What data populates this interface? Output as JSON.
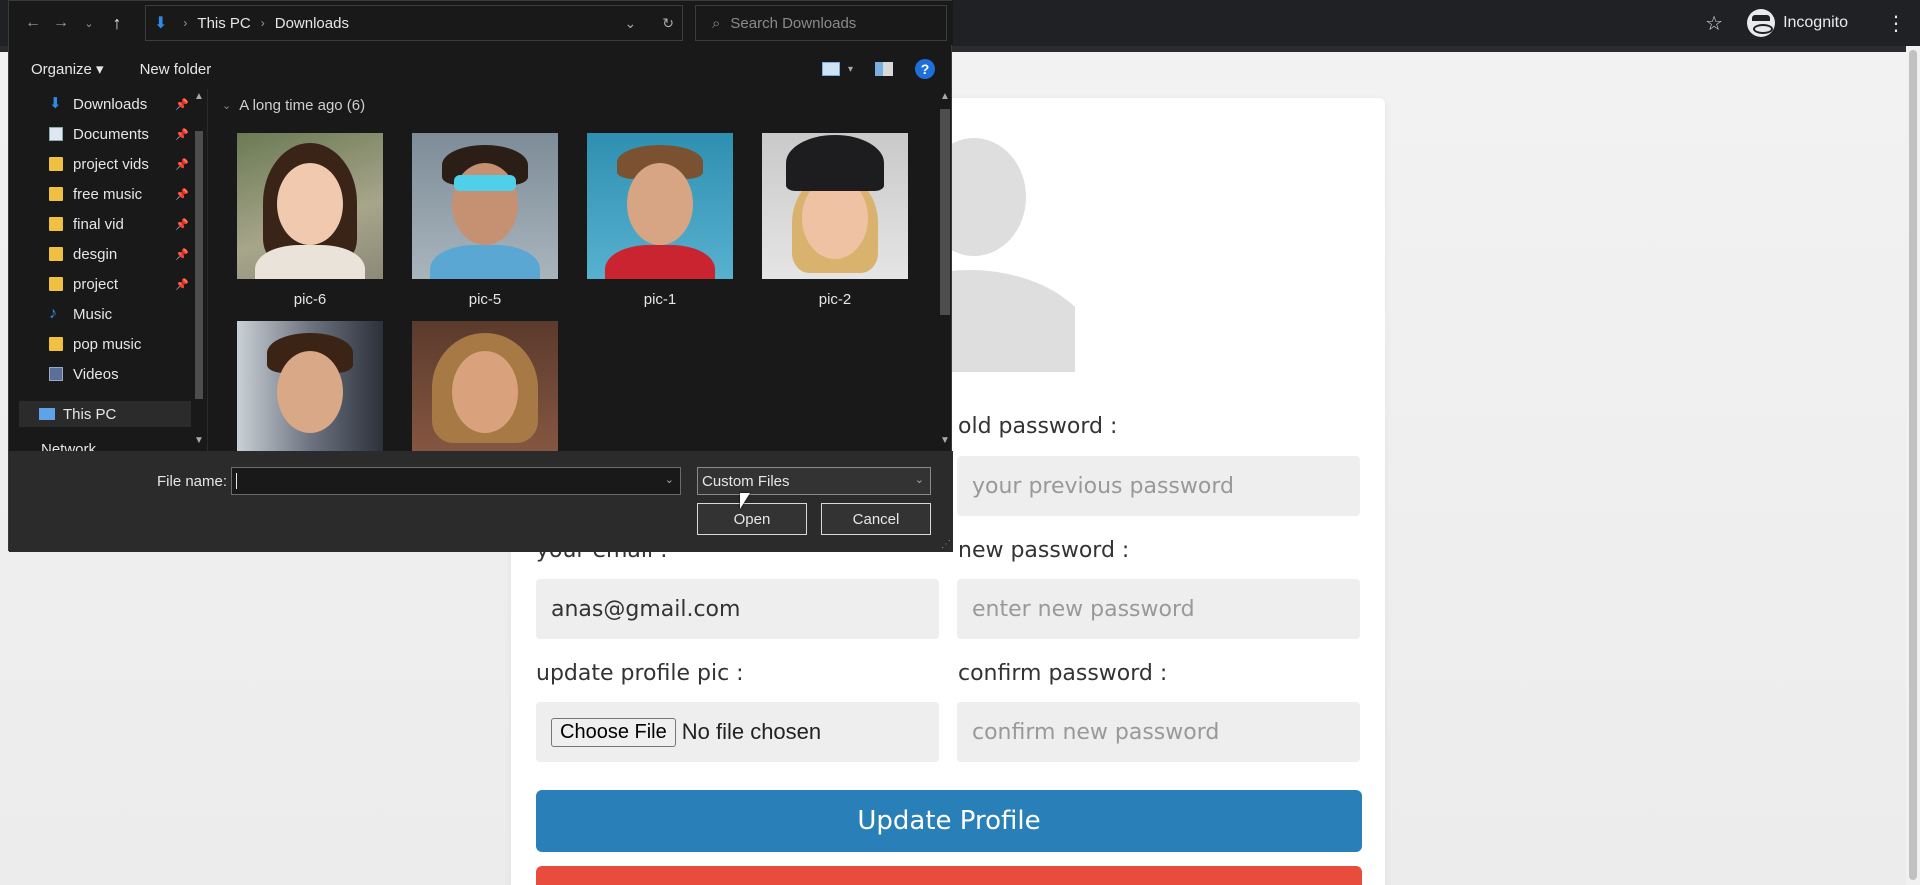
{
  "browser": {
    "incognito_label": "Incognito"
  },
  "dialog": {
    "breadcrumb": [
      "This PC",
      "Downloads"
    ],
    "search_placeholder": "Search Downloads",
    "toolbar": {
      "organize_label": "Organize ▾",
      "new_folder_label": "New folder",
      "help_label": "?"
    },
    "nav_items": [
      {
        "label": "Downloads",
        "icon": "download-icon",
        "pinned": true
      },
      {
        "label": "Documents",
        "icon": "document-icon",
        "pinned": true
      },
      {
        "label": "project vids",
        "icon": "folder-icon",
        "pinned": true
      },
      {
        "label": "free music",
        "icon": "folder-icon",
        "pinned": true
      },
      {
        "label": "final vid",
        "icon": "folder-icon",
        "pinned": true
      },
      {
        "label": "desgin",
        "icon": "folder-icon",
        "pinned": true
      },
      {
        "label": "project",
        "icon": "folder-icon",
        "pinned": true
      },
      {
        "label": "Music",
        "icon": "music-icon",
        "pinned": false
      },
      {
        "label": "pop music",
        "icon": "folder-icon",
        "pinned": false
      },
      {
        "label": "Videos",
        "icon": "video-icon",
        "pinned": false
      }
    ],
    "nav_selected": "This PC",
    "nav_partial": "Network",
    "group_header": "A long time ago (6)",
    "files": [
      {
        "name": "pic-6"
      },
      {
        "name": "pic-5"
      },
      {
        "name": "pic-1"
      },
      {
        "name": "pic-2"
      },
      {
        "name": ""
      },
      {
        "name": ""
      }
    ],
    "file_name_label": "File name:",
    "file_name_value": "",
    "file_type_selected": "Custom Files",
    "open_label": "Open",
    "cancel_label": "Cancel"
  },
  "form": {
    "old_password_label": "old password :",
    "old_password_placeholder": "your previous password",
    "email_label": "your email :",
    "email_value": "anas@gmail.com",
    "new_password_label": "new password :",
    "new_password_placeholder": "enter new password",
    "pic_label": "update profile pic :",
    "choose_file_label": "Choose File",
    "no_file_label": "No file chosen",
    "confirm_password_label": "confirm password :",
    "confirm_password_placeholder": "confirm new password",
    "update_label": "Update Profile"
  },
  "colors": {
    "primary_button": "#2980b9",
    "danger_button": "#e74c3c",
    "dialog_bg": "#191919",
    "folder_icon": "#f0c040"
  }
}
